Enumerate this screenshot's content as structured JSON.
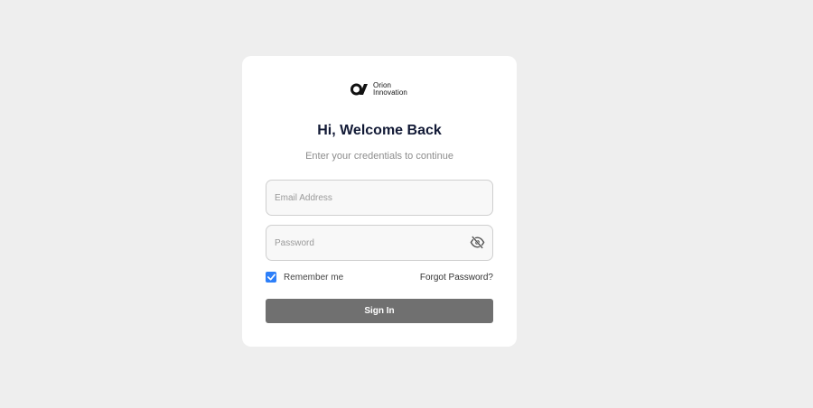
{
  "brand": {
    "line1": "Orion",
    "line2": "Innovation",
    "mark_icon": "orion-logo-mark"
  },
  "header": {
    "title": "Hi, Welcome Back",
    "subtitle": "Enter your credentials to continue"
  },
  "form": {
    "email": {
      "placeholder": "Email Address",
      "value": ""
    },
    "password": {
      "placeholder": "Password",
      "value": "",
      "toggle_icon": "eye-off-icon"
    },
    "remember_label": "Remember me",
    "remember_checked": true,
    "forgot_label": "Forgot Password?",
    "submit_label": "Sign In"
  },
  "colors": {
    "page_bg": "#eeeeee",
    "card_bg": "#ffffff",
    "title": "#121a36",
    "checkbox": "#2d7ff9",
    "button": "#707070"
  }
}
